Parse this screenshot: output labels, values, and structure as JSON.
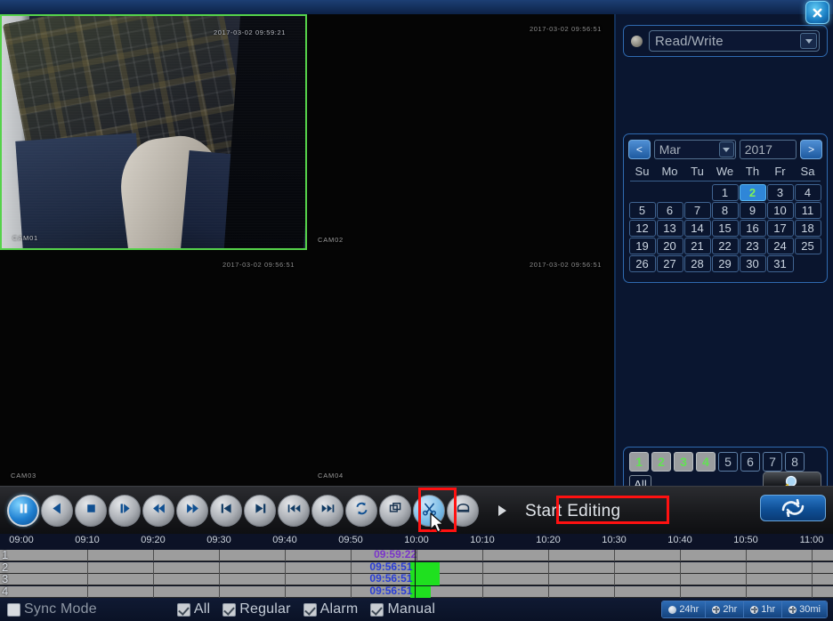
{
  "window": {
    "close_label": "close-icon"
  },
  "video": {
    "panes": [
      {
        "label": "CAM01",
        "timestamp": "2017-03-02 09:59:21",
        "active": true
      },
      {
        "label": "CAM02",
        "timestamp": "2017-03-02 09:56:51",
        "active": false
      },
      {
        "label": "CAM03",
        "timestamp": "2017-03-02 09:56:51",
        "active": false
      },
      {
        "label": "CAM04",
        "timestamp": "2017-03-02 09:56:51",
        "active": false
      }
    ]
  },
  "right_panel": {
    "device_select": {
      "value": "Read/Write",
      "led": "status-led"
    },
    "calendar": {
      "prev_label": "<",
      "next_label": ">",
      "month": "Mar",
      "year": "2017",
      "dow": [
        "Su",
        "Mo",
        "Tu",
        "We",
        "Th",
        "Fr",
        "Sa"
      ],
      "weeks": [
        [
          "",
          "",
          "",
          "1",
          "2",
          "3",
          "4"
        ],
        [
          "5",
          "6",
          "7",
          "8",
          "9",
          "10",
          "11"
        ],
        [
          "12",
          "13",
          "14",
          "15",
          "16",
          "17",
          "18"
        ],
        [
          "19",
          "20",
          "21",
          "22",
          "23",
          "24",
          "25"
        ],
        [
          "26",
          "27",
          "28",
          "29",
          "30",
          "31",
          ""
        ]
      ],
      "selected_day": "2"
    },
    "channels": {
      "items": [
        {
          "label": "1",
          "on": true
        },
        {
          "label": "2",
          "on": true
        },
        {
          "label": "3",
          "on": true
        },
        {
          "label": "4",
          "on": true
        },
        {
          "label": "5",
          "on": false
        },
        {
          "label": "6",
          "on": false
        },
        {
          "label": "7",
          "on": false
        },
        {
          "label": "8",
          "on": false
        }
      ],
      "all_label": "All",
      "search_label": "search-icon"
    }
  },
  "toolbar": {
    "buttons": [
      {
        "name": "pause-button",
        "icon": "pause",
        "primary": true
      },
      {
        "name": "play-reverse-button",
        "icon": "play-left",
        "primary": false
      },
      {
        "name": "stop-button",
        "icon": "stop",
        "primary": false
      },
      {
        "name": "slow-forward-button",
        "icon": "slow",
        "primary": false
      },
      {
        "name": "rewind-button",
        "icon": "rewind",
        "primary": false
      },
      {
        "name": "fast-forward-button",
        "icon": "fastforward",
        "primary": false
      },
      {
        "name": "prev-frame-button",
        "icon": "prev-frame",
        "primary": false
      },
      {
        "name": "next-frame-button",
        "icon": "next-frame",
        "primary": false
      },
      {
        "name": "prev-file-button",
        "icon": "prev-file",
        "primary": false
      },
      {
        "name": "next-file-button",
        "icon": "next-file",
        "primary": false
      },
      {
        "name": "repeat-button",
        "icon": "repeat",
        "primary": false
      },
      {
        "name": "multi-window-button",
        "icon": "windows",
        "primary": false
      },
      {
        "name": "clip-scissors-button",
        "icon": "scissors",
        "primary": false
      },
      {
        "name": "backup-disk-button",
        "icon": "disk",
        "primary": false
      }
    ],
    "more_label": "more-arrow-icon",
    "start_editing_label": "Start Editing",
    "backup_button_label": "backup-icon"
  },
  "timeline": {
    "ticks": [
      "09:00",
      "09:10",
      "09:20",
      "09:30",
      "09:40",
      "09:50",
      "10:00",
      "10:10",
      "10:20",
      "10:30",
      "10:40",
      "10:50",
      "11:00"
    ],
    "rows": [
      {
        "num": "1",
        "time_label": "09:59:22",
        "time_color": "#7a35c9",
        "rec_start_pct": 49.8,
        "rec_width_pct": 0.0
      },
      {
        "num": "2",
        "time_label": "09:56:51",
        "time_color": "#2b3fd6",
        "rec_start_pct": 49.3,
        "rec_width_pct": 3.5
      },
      {
        "num": "3",
        "time_label": "09:56:51",
        "time_color": "#2b3fd6",
        "rec_start_pct": 49.3,
        "rec_width_pct": 3.5
      },
      {
        "num": "4",
        "time_label": "09:56:51",
        "time_color": "#2b3fd6",
        "rec_start_pct": 49.3,
        "rec_width_pct": 2.4
      }
    ]
  },
  "bottom_bar": {
    "sync_mode": {
      "label": "Sync Mode",
      "checked": false
    },
    "filters": [
      {
        "label": "All",
        "checked": true
      },
      {
        "label": "Regular",
        "checked": true
      },
      {
        "label": "Alarm",
        "checked": true
      },
      {
        "label": "Manual",
        "checked": true
      }
    ],
    "zoom_options": [
      {
        "label": "24hr",
        "selected": true
      },
      {
        "label": "2hr",
        "selected": false
      },
      {
        "label": "1hr",
        "selected": false
      },
      {
        "label": "30mi",
        "selected": false
      }
    ]
  },
  "annotations": {
    "highlight_scissors": "red-highlight-box",
    "highlight_label": "red-highlight-box"
  }
}
